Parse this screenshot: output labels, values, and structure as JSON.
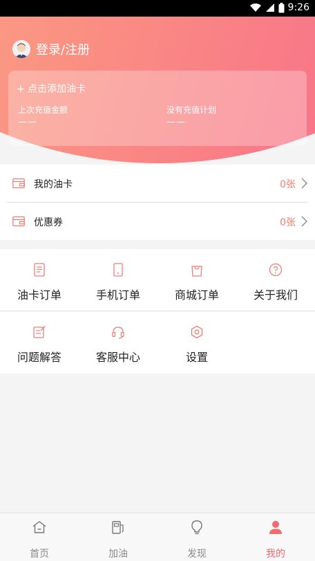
{
  "status_bar": {
    "time": "9:26"
  },
  "header": {
    "login_label": "登录/注册"
  },
  "card": {
    "add_label": "+ 点击添加油卡",
    "last_amount_label": "上次充值金额",
    "last_amount_value": "——",
    "plan_label": "没有充值计划",
    "plan_value": "——"
  },
  "list": {
    "items": [
      {
        "label": "我的油卡",
        "count": "0张",
        "icon": "wallet-icon"
      },
      {
        "label": "优惠券",
        "count": "0张",
        "icon": "wallet-icon"
      }
    ]
  },
  "grid": {
    "items": [
      {
        "label": "油卡订单",
        "icon": "document-icon"
      },
      {
        "label": "手机订单",
        "icon": "phone-icon"
      },
      {
        "label": "商城订单",
        "icon": "shopping-bag-icon"
      },
      {
        "label": "关于我们",
        "icon": "question-icon"
      },
      {
        "label": "问题解答",
        "icon": "edit-note-icon"
      },
      {
        "label": "客服中心",
        "icon": "headset-icon"
      },
      {
        "label": "设置",
        "icon": "settings-hexagon-icon"
      }
    ]
  },
  "tabbar": {
    "tabs": [
      {
        "label": "首页",
        "icon": "home-icon"
      },
      {
        "label": "加油",
        "icon": "fuel-pump-icon"
      },
      {
        "label": "发现",
        "icon": "bulb-icon"
      },
      {
        "label": "我的",
        "icon": "user-icon",
        "active": true
      }
    ]
  },
  "colors": {
    "accent": "#f06a70",
    "gradient_start": "#fcb889",
    "gradient_end": "#f7648d"
  }
}
